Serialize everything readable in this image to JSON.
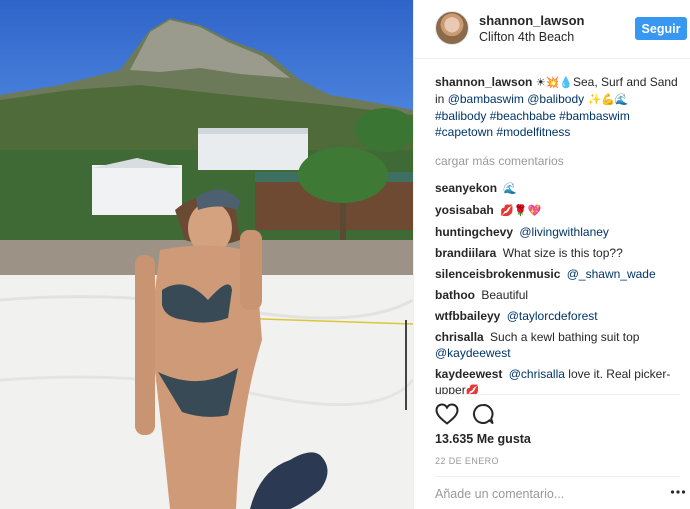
{
  "post": {
    "username": "shannon_lawson",
    "location": "Clifton 4th Beach",
    "follow_label": "Seguir",
    "caption": {
      "username": "shannon_lawson",
      "text_1": "Sea, Surf and Sand in",
      "mention_1": "@bambaswim",
      "mention_2": "@balibody",
      "hashtags": [
        "#balibody",
        "#beachbabe",
        "#bambaswim",
        "#capetown",
        "#modelfitness"
      ]
    },
    "load_more_label": "cargar más comentarios",
    "comments": [
      {
        "user": "seanyekon",
        "text": "",
        "emoji": "🌊"
      },
      {
        "user": "yosisabah",
        "text": "",
        "emoji": "💋🌹💖"
      },
      {
        "user": "huntingchevy",
        "text": "",
        "mention": "@livingwithlaney"
      },
      {
        "user": "brandiilara",
        "text": "What size is this top??"
      },
      {
        "user": "silenceisbrokenmusic",
        "text": "",
        "mention": "@_shawn_wade"
      },
      {
        "user": "bathoo",
        "text": "Beautiful"
      },
      {
        "user": "wtfbbaileyy",
        "text": "",
        "mention": "@taylorcdeforest"
      },
      {
        "user": "chrisalla",
        "text": "Such a kewl bathing suit top",
        "mention": "@kaydeewest"
      },
      {
        "user": "kaydeewest",
        "text": "love it. Real picker-upper",
        "mention": "@chrisalla",
        "emoji": "💋"
      }
    ],
    "likes": "13.635 Me gusta",
    "date": "22 DE ENERO",
    "comment_placeholder": "Añade un comentario...",
    "colors": {
      "follow_button": "#3897f0",
      "link": "#003569",
      "muted": "#999999"
    },
    "icons": {
      "like": "heart-outline-icon",
      "comment": "comment-bubble-icon",
      "options": "more-options-icon"
    }
  }
}
